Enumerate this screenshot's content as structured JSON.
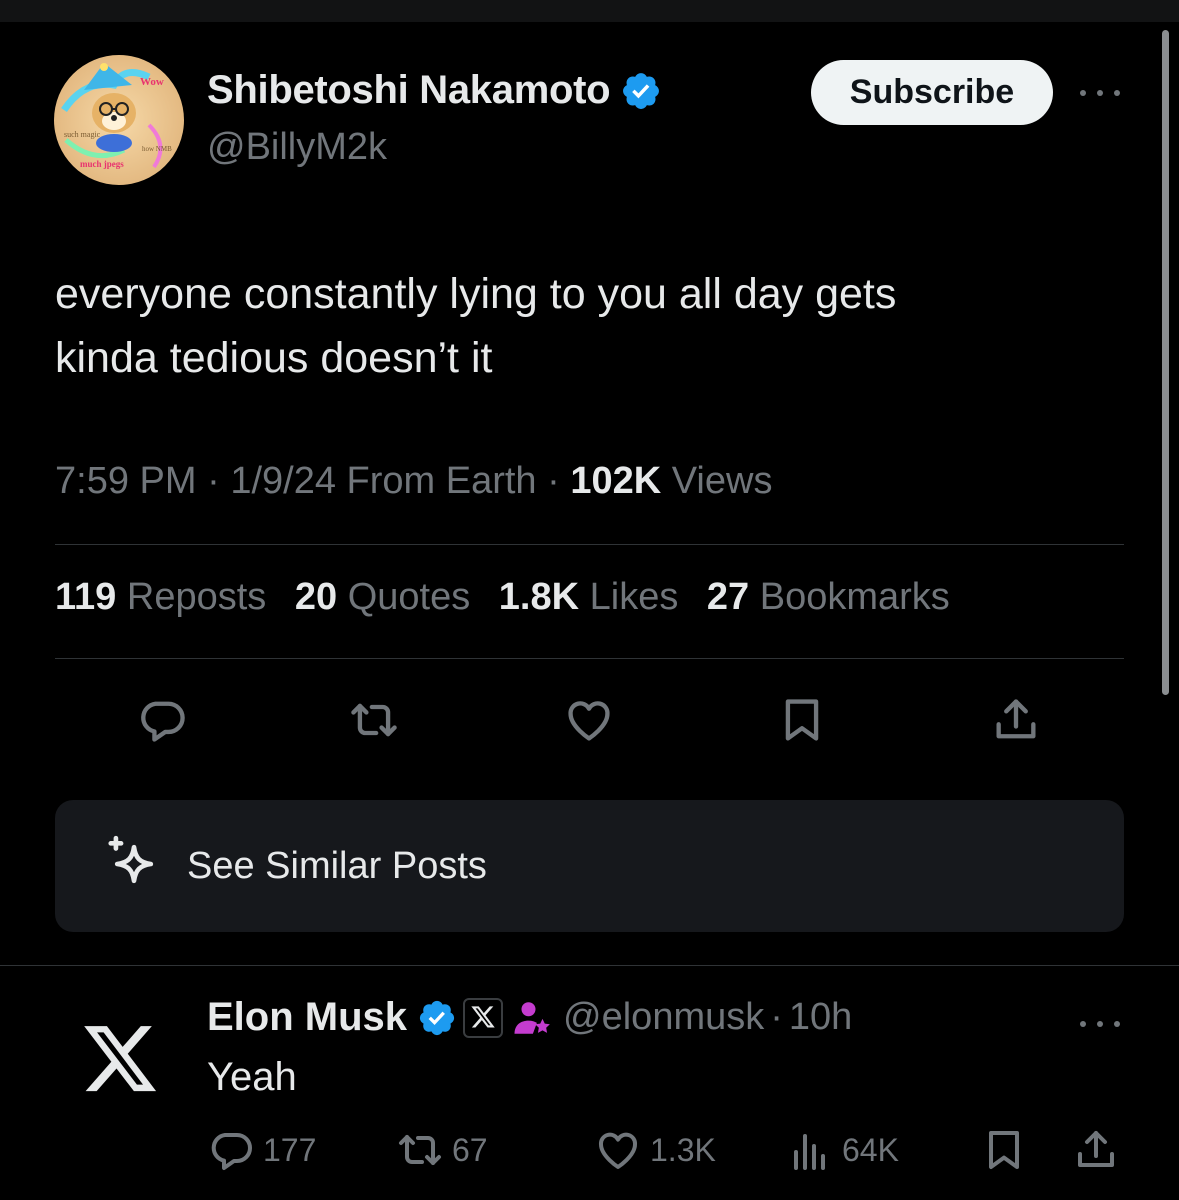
{
  "tweet": {
    "author": {
      "display_name": "Shibetoshi Nakamoto",
      "handle": "@BillyM2k",
      "verified_color": "#1d9bf0",
      "avatar_text": [
        "Wow",
        "such magic",
        "much jpegs",
        "how NMB"
      ]
    },
    "subscribe_label": "Subscribe",
    "text_lines": [
      "everyone constantly lying to you all day gets",
      "kinda tedious doesn’t it"
    ],
    "time": "7:59 PM",
    "date": "1/9/24",
    "source": "From Earth",
    "views_count": "102K",
    "views_label": "Views",
    "stats": [
      {
        "num": "119",
        "label": "Reposts"
      },
      {
        "num": "20",
        "label": "Quotes"
      },
      {
        "num": "1.8K",
        "label": "Likes"
      },
      {
        "num": "27",
        "label": "Bookmarks"
      }
    ],
    "actions": [
      "reply-icon",
      "repost-icon",
      "like-icon",
      "bookmark-icon",
      "share-icon"
    ]
  },
  "similar_posts": {
    "label": "See Similar Posts"
  },
  "reply": {
    "author": {
      "display_name": "Elon Musk",
      "handle": "@elonmusk",
      "time": "10h"
    },
    "text": "Yeah",
    "counts": {
      "replies": "177",
      "reposts": "67",
      "likes": "1.3K",
      "views": "64K"
    },
    "badge_colors": {
      "verified": "#1d9bf0",
      "person": "#c43ccf"
    }
  },
  "colors": {
    "background": "#000000",
    "text": "#e7e9ea",
    "muted": "#71767b",
    "divider": "#2f3336",
    "card": "#16181c"
  }
}
